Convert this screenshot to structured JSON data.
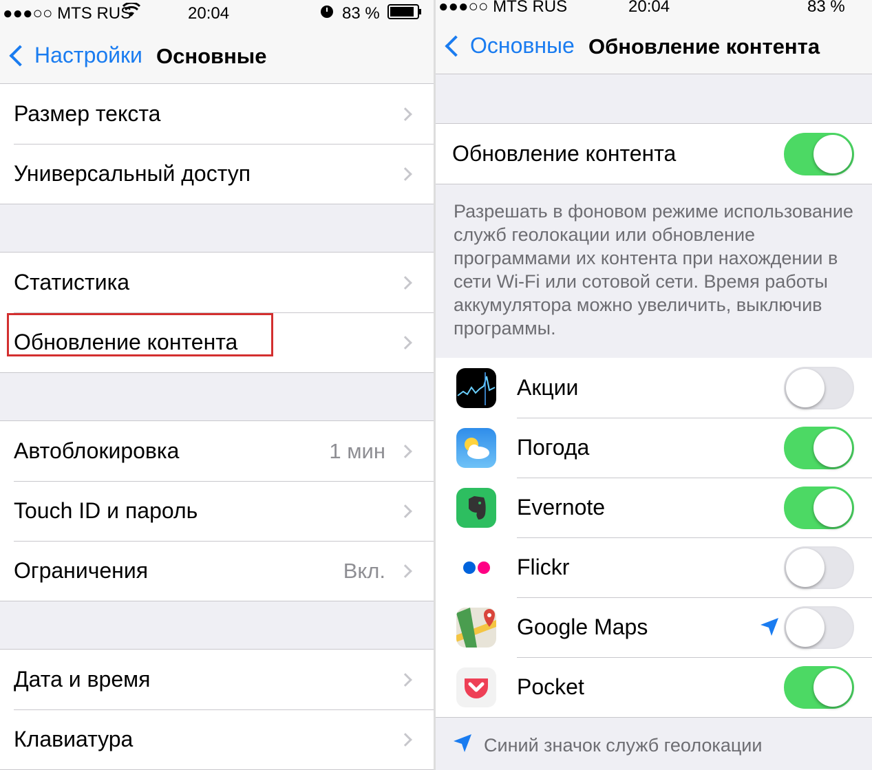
{
  "left": {
    "status": {
      "carrier": "●●●○○ MTS RUS",
      "time": "20:04",
      "battery": "83 %"
    },
    "nav": {
      "back_label": "Настройки",
      "title": "Основные"
    },
    "groups": [
      [
        {
          "label": "Размер текста",
          "detail": ""
        },
        {
          "label": "Универсальный доступ",
          "detail": ""
        }
      ],
      [
        {
          "label": "Статистика",
          "detail": ""
        },
        {
          "label": "Обновление контента",
          "detail": ""
        }
      ],
      [
        {
          "label": "Автоблокировка",
          "detail": "1 мин"
        },
        {
          "label": "Touch ID и пароль",
          "detail": ""
        },
        {
          "label": "Ограничения",
          "detail": "Вкл."
        }
      ],
      [
        {
          "label": "Дата и время",
          "detail": ""
        },
        {
          "label": "Клавиатура",
          "detail": ""
        }
      ]
    ]
  },
  "right": {
    "status": {
      "carrier": "●●●○○ MTS RUS",
      "time": "20:04",
      "battery": "83 %"
    },
    "nav": {
      "back_label": "Основные",
      "title": "Обновление контента"
    },
    "master": {
      "label": "Обновление контента",
      "on": true
    },
    "description": "Разрешать в фоновом режиме использование служб геолокации или обновление программами их контента при нахождении в сети Wi-Fi или сотовой сети. Время работы аккумулятора можно увеличить, выключив программы.",
    "apps": [
      {
        "name": "Акции",
        "icon": "stocks-icon",
        "on": false,
        "location": false
      },
      {
        "name": "Погода",
        "icon": "weather-icon",
        "on": true,
        "location": false
      },
      {
        "name": "Evernote",
        "icon": "evernote-icon",
        "on": true,
        "location": false
      },
      {
        "name": "Flickr",
        "icon": "flickr-icon",
        "on": false,
        "location": false
      },
      {
        "name": "Google Maps",
        "icon": "google-maps-icon",
        "on": false,
        "location": true
      },
      {
        "name": "Pocket",
        "icon": "pocket-icon",
        "on": true,
        "location": false
      }
    ],
    "bottom_note": "Синий значок служб геолокации"
  },
  "colors": {
    "accent": "#1a7cf0",
    "toggle_on": "#4cd964",
    "highlight": "#d32f2f",
    "separator": "#c8c7cc"
  }
}
